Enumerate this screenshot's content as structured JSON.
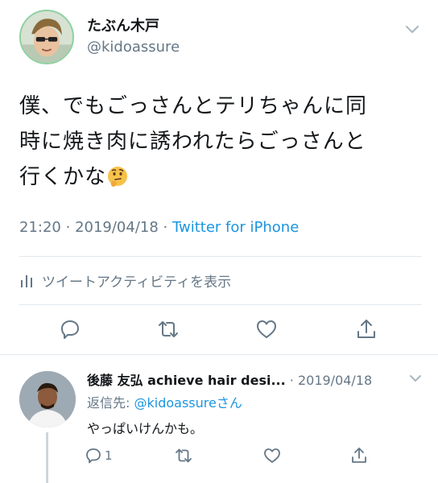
{
  "tweet": {
    "display_name": "たぶん木戸",
    "handle": "@kidoassure",
    "text_lines": [
      "僕、でもごっさんとテリちゃんに同",
      "時に焼き肉に誘われたらごっさんと",
      "行くかな"
    ],
    "emoji": "thinking-face",
    "time": "21:20",
    "date": "2019/04/18",
    "source": "Twitter for iPhone",
    "activity_label": "ツイートアクティビティを表示"
  },
  "reply": {
    "display_name": "後藤 友弘 achieve hair desi...",
    "date": "2019/04/18",
    "reply_to_prefix": "返信先: ",
    "reply_to_mention": "@kidoassure",
    "reply_to_suffix": "さん",
    "text": "やっぱいけんかも。",
    "reply_count": "1"
  },
  "icons": [
    "chevron-down-icon",
    "activity-bars-icon",
    "reply-icon",
    "retweet-icon",
    "like-icon",
    "share-icon"
  ],
  "colors": {
    "link_blue": "#1b95e0",
    "secondary_gray": "#657786",
    "divider": "#e1e8ed",
    "avatar_ring": "#8ed1a0"
  }
}
